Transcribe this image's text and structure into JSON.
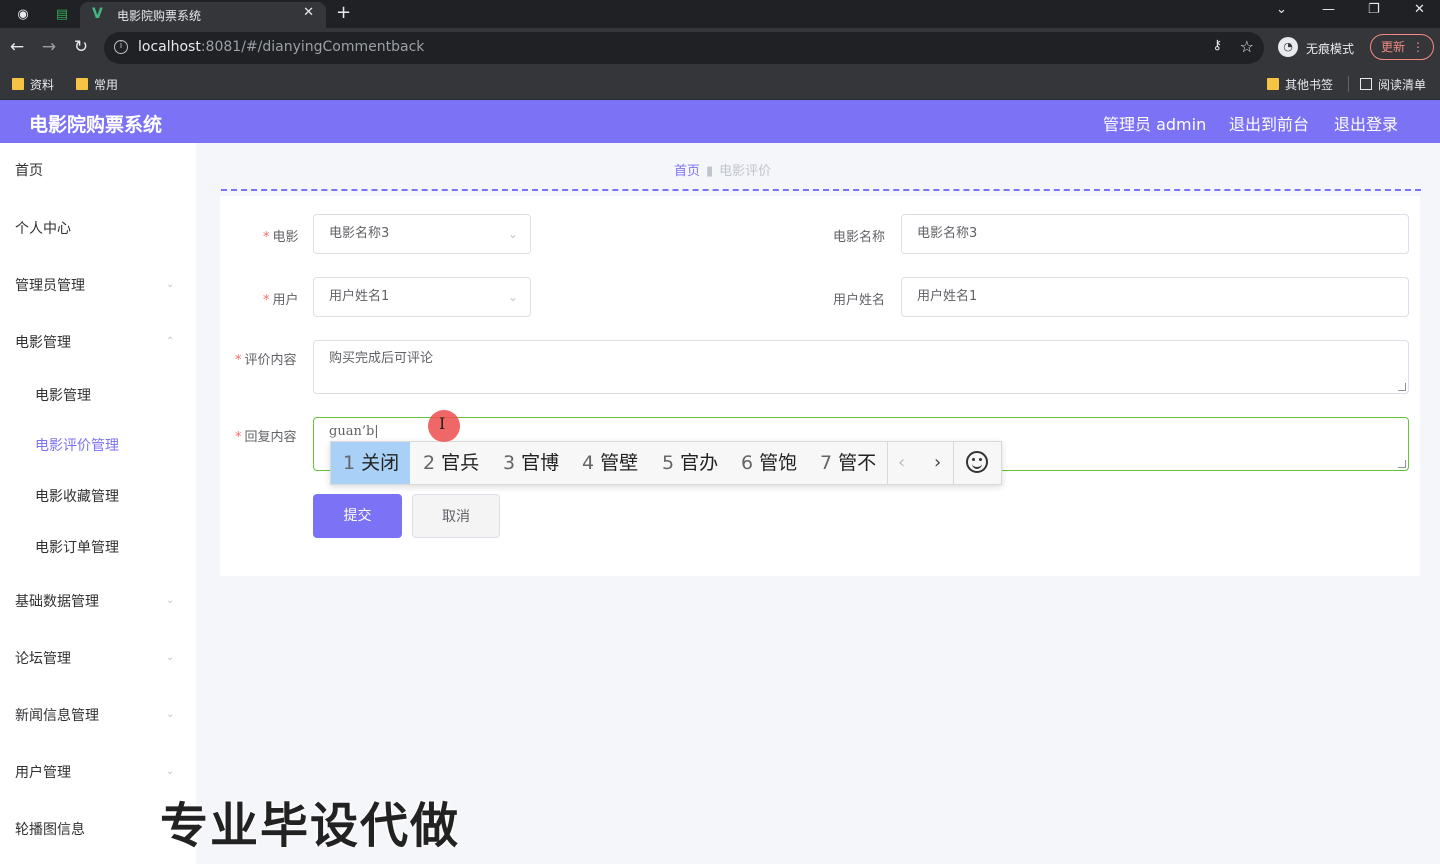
{
  "browser": {
    "tab_title": "电影院购票系统",
    "url_host": "localhost",
    "url_rest": ":8081/#/dianyingCommentback",
    "incognito_label": "无痕模式",
    "update_label": "更新",
    "bookmarks": [
      "资料",
      "常用"
    ],
    "bookmarks_right": [
      "其他书签",
      "阅读清单"
    ]
  },
  "app": {
    "title": "电影院购票系统",
    "header_links": [
      "管理员 admin",
      "退出到前台",
      "退出登录"
    ]
  },
  "sidebar": {
    "items": [
      {
        "label": "首页",
        "sub": false,
        "active": false
      },
      {
        "label": "个人中心",
        "sub": false,
        "active": false
      },
      {
        "label": "管理员管理",
        "sub": false,
        "active": false
      },
      {
        "label": "电影管理",
        "sub": false,
        "active": false
      },
      {
        "label": "电影管理",
        "sub": true,
        "active": false
      },
      {
        "label": "电影评价管理",
        "sub": true,
        "active": true
      },
      {
        "label": "电影收藏管理",
        "sub": true,
        "active": false
      },
      {
        "label": "电影订单管理",
        "sub": true,
        "active": false
      },
      {
        "label": "基础数据管理",
        "sub": false,
        "active": false
      },
      {
        "label": "论坛管理",
        "sub": false,
        "active": false
      },
      {
        "label": "新闻信息管理",
        "sub": false,
        "active": false
      },
      {
        "label": "用户管理",
        "sub": false,
        "active": false
      },
      {
        "label": "轮播图信息",
        "sub": false,
        "active": false
      }
    ]
  },
  "breadcrumb": {
    "home": "首页",
    "current": "电影评价"
  },
  "form": {
    "movie_label": "电影",
    "movie_value": "电影名称3",
    "movie_name_label": "电影名称",
    "movie_name_value": "电影名称3",
    "user_label": "用户",
    "user_value": "用户姓名1",
    "user_name_label": "用户姓名",
    "user_name_value": "用户姓名1",
    "comment_label": "评价内容",
    "comment_value": "购买完成后可评论",
    "reply_label": "回复内容",
    "reply_value": "guan’b|",
    "submit_label": "提交",
    "cancel_label": "取消"
  },
  "ime": {
    "candidates": [
      {
        "num": "1",
        "text": "关闭"
      },
      {
        "num": "2",
        "text": "官兵"
      },
      {
        "num": "3",
        "text": "官博"
      },
      {
        "num": "4",
        "text": "管壁"
      },
      {
        "num": "5",
        "text": "官办"
      },
      {
        "num": "6",
        "text": "管饱"
      },
      {
        "num": "7",
        "text": "管不"
      }
    ]
  },
  "watermark": "专业毕设代做",
  "colors": {
    "accent": "#7c72f5",
    "focus": "#67c23a",
    "required": "#f56c6c"
  }
}
